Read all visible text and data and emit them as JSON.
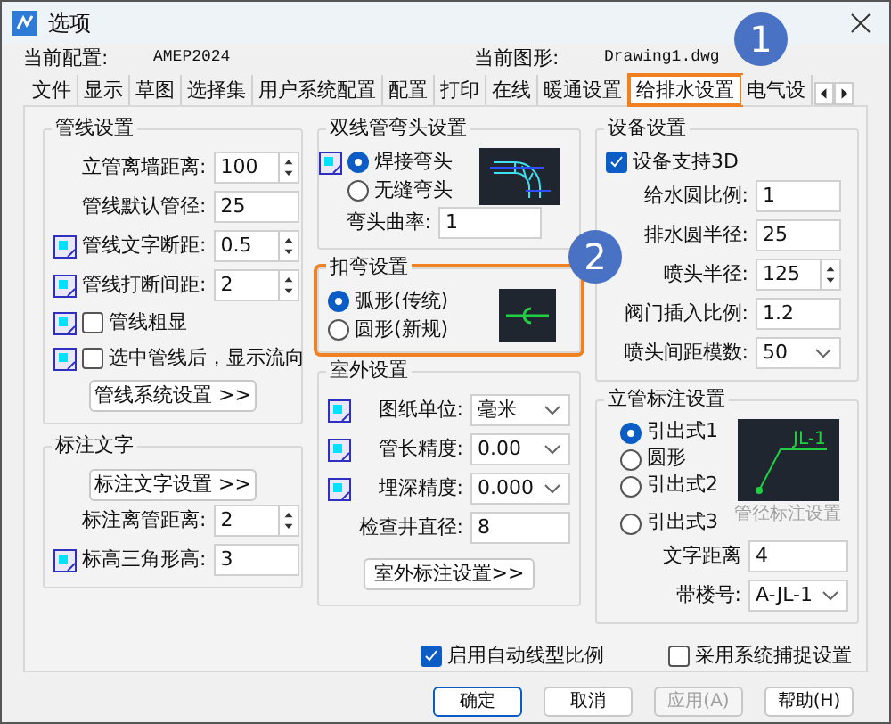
{
  "window": {
    "title": "选项"
  },
  "profile": {
    "label": "当前配置:",
    "value": "AMEP2024"
  },
  "drawing": {
    "label": "当前图形:",
    "value": "Drawing1.dwg"
  },
  "tabs": [
    {
      "label": "文件",
      "selected": false,
      "highlighted": false
    },
    {
      "label": "显示",
      "selected": false,
      "highlighted": false
    },
    {
      "label": "草图",
      "selected": false,
      "highlighted": false
    },
    {
      "label": "选择集",
      "selected": false,
      "highlighted": false
    },
    {
      "label": "用户系统配置",
      "selected": false,
      "highlighted": false
    },
    {
      "label": "配置",
      "selected": false,
      "highlighted": false
    },
    {
      "label": "打印",
      "selected": false,
      "highlighted": false
    },
    {
      "label": "在线",
      "selected": false,
      "highlighted": false
    },
    {
      "label": "暖通设置",
      "selected": false,
      "highlighted": false
    },
    {
      "label": "给排水设置",
      "selected": true,
      "highlighted": true
    },
    {
      "label": "电气设",
      "selected": false,
      "highlighted": false
    }
  ],
  "pipe_settings": {
    "title": "管线设置",
    "rows": [
      {
        "label": "立管离墙距离:",
        "value": "100",
        "kind": "spin",
        "icon": false
      },
      {
        "label": "管线默认管径:",
        "value": "25",
        "kind": "text",
        "icon": false
      },
      {
        "label": "管线文字断距:",
        "value": "0.5",
        "kind": "spin",
        "icon": true
      },
      {
        "label": "管线打断间距:",
        "value": "2",
        "kind": "spin",
        "icon": true
      }
    ],
    "checks": [
      {
        "label": "管线粗显",
        "checked": false,
        "icon": true
      },
      {
        "label": "选中管线后，显示流向",
        "checked": false,
        "icon": true
      }
    ],
    "button": "管线系统设置 >>"
  },
  "annotation_text": {
    "title": "标注文字",
    "button": "标注文字设置 >>",
    "rows": [
      {
        "label": "标注离管距离:",
        "value": "2",
        "kind": "spin",
        "icon": false
      },
      {
        "label": "标高三角形高:",
        "value": "3",
        "kind": "text",
        "icon": true
      }
    ]
  },
  "elbow": {
    "title": "双线管弯头设置",
    "options": [
      {
        "label": "焊接弯头",
        "selected": true,
        "icon": true
      },
      {
        "label": "无缝弯头",
        "selected": false,
        "icon": false
      }
    ],
    "radius": {
      "label": "弯头曲率:",
      "value": "1"
    }
  },
  "bend": {
    "title": "扣弯设置",
    "highlighted": true,
    "options": [
      {
        "label": "弧形(传统)",
        "selected": true
      },
      {
        "label": "圆形(新规)",
        "selected": false
      }
    ]
  },
  "outdoor": {
    "title": "室外设置",
    "rows": [
      {
        "label": "图纸单位:",
        "value": "毫米",
        "kind": "select",
        "icon": true
      },
      {
        "label": "管长精度:",
        "value": "0.00",
        "kind": "select",
        "icon": true
      },
      {
        "label": "埋深精度:",
        "value": "0.000",
        "kind": "select",
        "icon": true
      },
      {
        "label": "检查井直径:",
        "value": "8",
        "kind": "text",
        "icon": false
      }
    ],
    "button": "室外标注设置>>"
  },
  "equipment": {
    "title": "设备设置",
    "check": {
      "label": "设备支持3D",
      "checked": true
    },
    "rows": [
      {
        "label": "给水圆比例:",
        "value": "1",
        "kind": "text"
      },
      {
        "label": "排水圆半径:",
        "value": "25",
        "kind": "text"
      },
      {
        "label": "喷头半径:",
        "value": "125",
        "kind": "spin"
      },
      {
        "label": "阀门插入比例:",
        "value": "1.2",
        "kind": "text"
      },
      {
        "label": "喷头间距模数:",
        "value": "50",
        "kind": "select"
      }
    ]
  },
  "riser": {
    "title": "立管标注设置",
    "preview_label": "JL-1",
    "options": [
      {
        "label": "引出式1",
        "selected": true
      },
      {
        "label": "圆形",
        "selected": false
      },
      {
        "label": "引出式2",
        "selected": false
      },
      {
        "label": "引出式3",
        "selected": false
      }
    ],
    "link": {
      "label": "管径标注设置",
      "disabled": true
    },
    "rows": [
      {
        "label": "文字距离",
        "value": "4",
        "kind": "text"
      },
      {
        "label": "带楼号:",
        "value": "A-JL-1",
        "kind": "select"
      }
    ]
  },
  "bottom_checks": [
    {
      "label": "启用自动线型比例",
      "checked": true
    },
    {
      "label": "采用系统捕捉设置",
      "checked": false
    }
  ],
  "buttons": [
    {
      "label": "确定",
      "default": true,
      "disabled": false
    },
    {
      "label": "取消",
      "default": false,
      "disabled": false
    },
    {
      "label": "应用(A)",
      "default": false,
      "disabled": true
    },
    {
      "label": "帮助(H)",
      "default": false,
      "disabled": false
    }
  ],
  "callouts": [
    "1",
    "2"
  ]
}
